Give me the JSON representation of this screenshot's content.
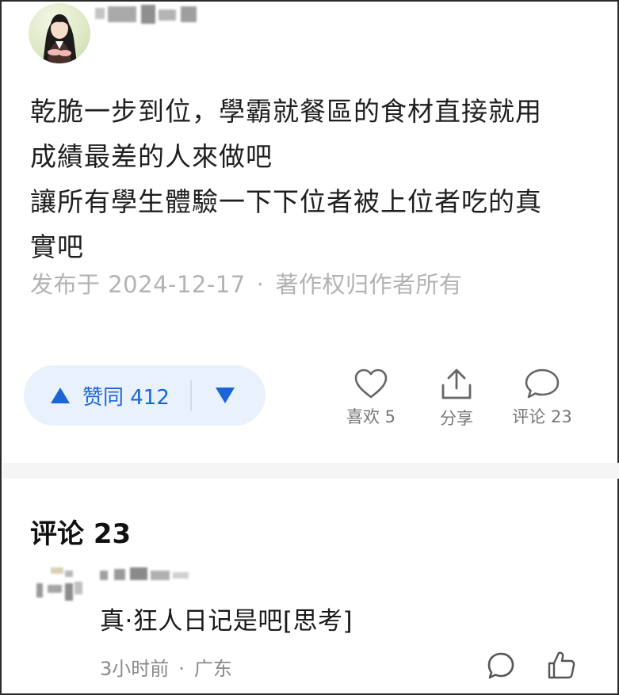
{
  "post": {
    "lines": [
      "乾脆一步到位，學霸就餐區的食材直接就用",
      "成績最差的人來做吧",
      "讓所有學生體驗一下下位者被上位者吃的真",
      "實吧"
    ],
    "meta": {
      "published": "发布于 2024-12-17",
      "dot": "·",
      "copyright": "著作权归作者所有"
    }
  },
  "actions": {
    "upvote_label": "赞同 412",
    "like_label": "喜欢 5",
    "share_label": "分享",
    "comment_label": "评论 23"
  },
  "comments": {
    "title": "评论 23",
    "items": [
      {
        "text": "真·狂人日记是吧[思考]",
        "time": "3小时前",
        "dot": "·",
        "location": "广东"
      }
    ]
  },
  "colors": {
    "accent": "#1a66d6",
    "pill_bg": "#e9f1fc",
    "meta_gray": "#b3b3b3",
    "icon_gray": "#666666"
  },
  "icons": {
    "upvote": "triangle-up-icon",
    "downvote": "triangle-down-icon",
    "like": "heart-icon",
    "share": "share-icon",
    "comment": "comment-bubble-icon",
    "reply": "reply-bubble-icon",
    "thumb": "thumbs-up-icon"
  }
}
